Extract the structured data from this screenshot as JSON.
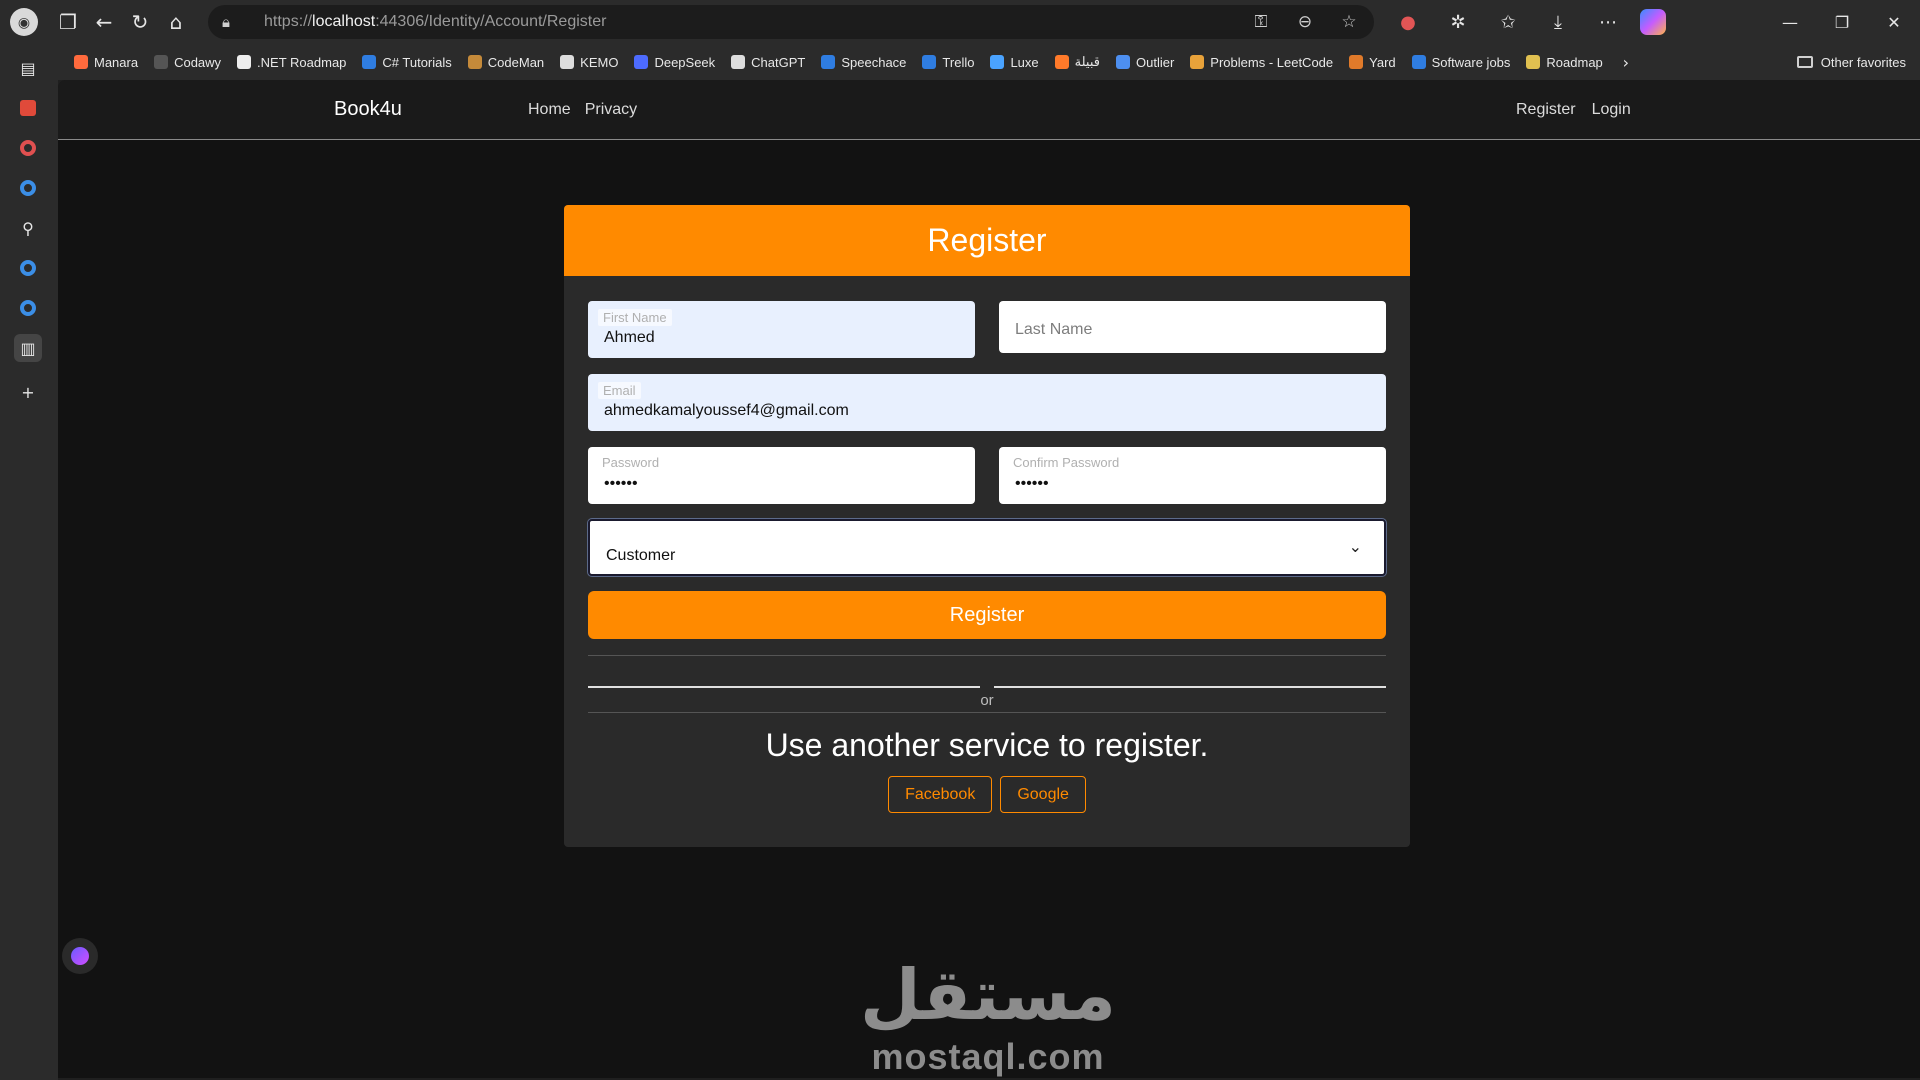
{
  "browser": {
    "url_prefix": "https://",
    "url_host": "localhost",
    "url_rest": ":44306/Identity/Account/Register",
    "bookmarks": [
      "Manara",
      "Codawy",
      ".NET Roadmap",
      "C# Tutorials",
      "CodeMan",
      "KEMO",
      "DeepSeek",
      "ChatGPT",
      "Speechace",
      "Trello",
      "Luxe",
      "قبيلة",
      "Outlier",
      "Problems - LeetCode",
      "Yard",
      "Software jobs",
      "Roadmap"
    ],
    "other_favorites": "Other favorites"
  },
  "navbar": {
    "brand": "Book4u",
    "links": [
      "Home",
      "Privacy"
    ],
    "right_links": [
      "Register",
      "Login"
    ]
  },
  "form": {
    "title": "Register",
    "first_name_label": "First Name",
    "first_name_value": "Ahmed",
    "last_name_placeholder": "Last Name",
    "email_label": "Email",
    "email_value": "ahmedkamalyoussef4@gmail.com",
    "password_label": "Password",
    "password_value": "••••••",
    "confirm_label": "Confirm Password",
    "confirm_value": "••••••",
    "role_value": "Customer",
    "submit_label": "Register",
    "or_text": "or",
    "alt_title": "Use another service to register.",
    "alt_buttons": [
      "Facebook",
      "Google"
    ]
  },
  "watermark": {
    "logo": "مستقل",
    "text": "mostaql.com"
  },
  "colors": {
    "accent": "#ff8a00",
    "background": "#121212",
    "card": "#2a2a2a"
  }
}
